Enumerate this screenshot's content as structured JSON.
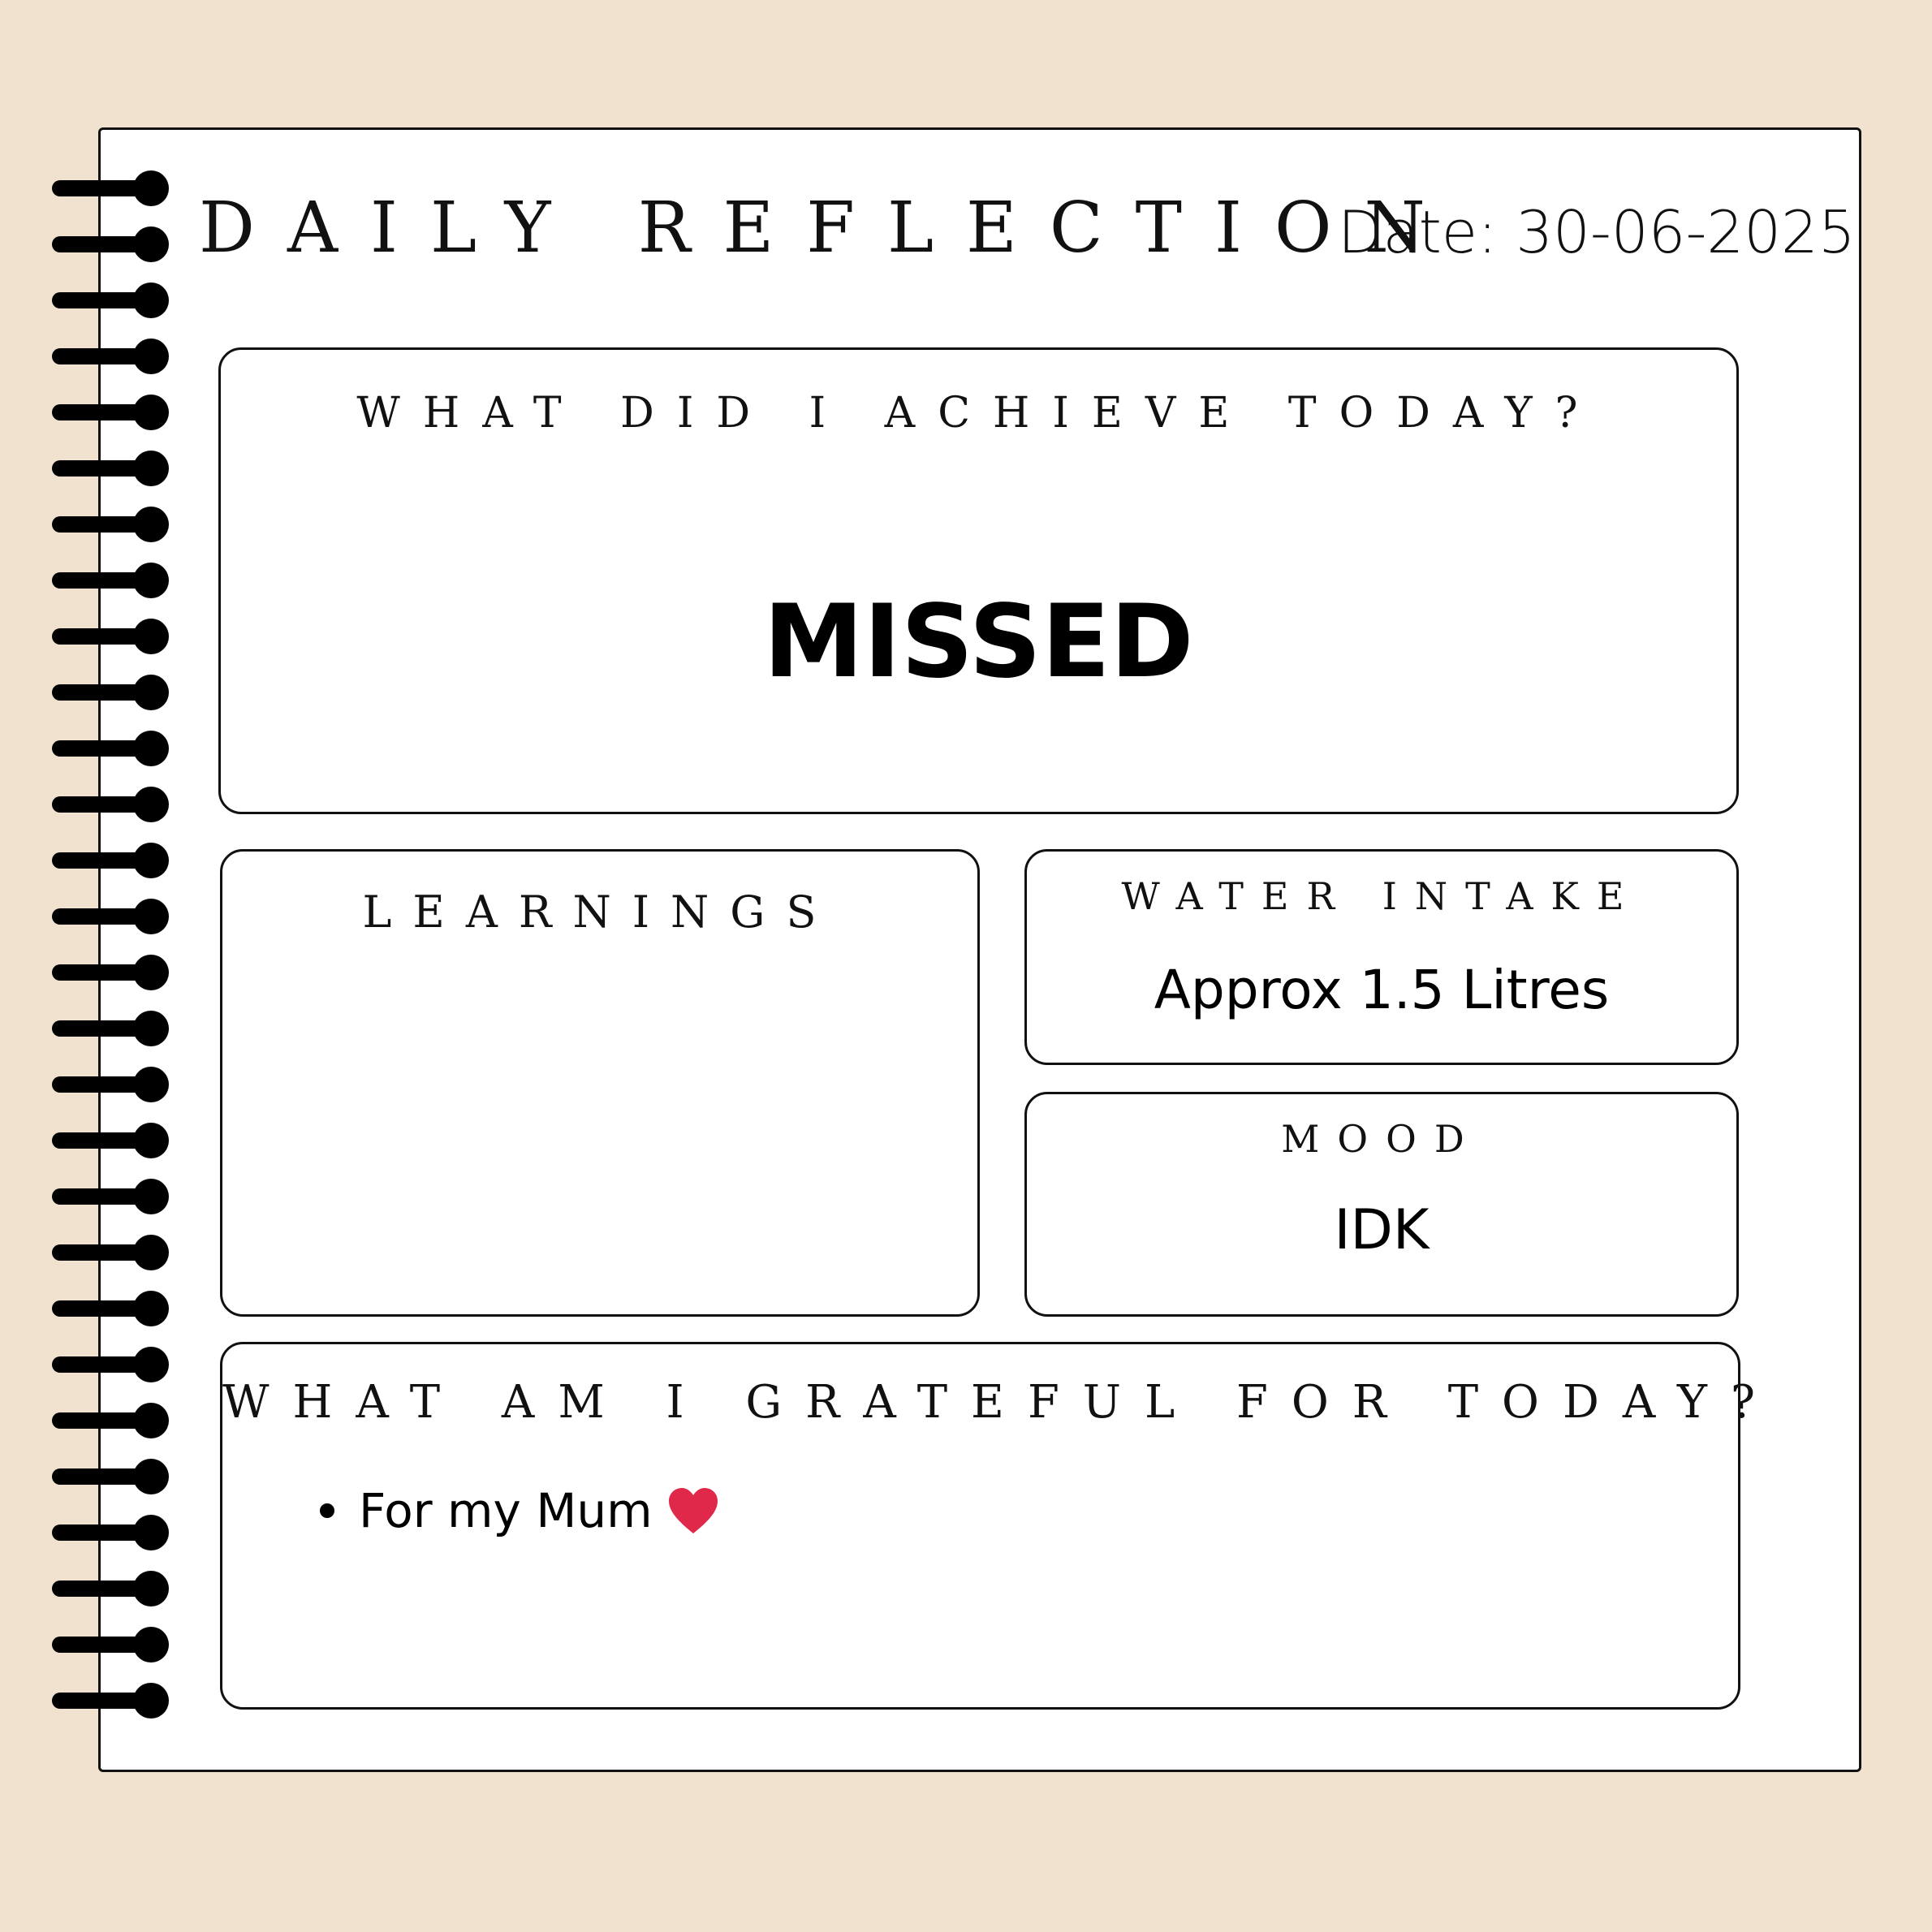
{
  "header": {
    "title": "DAILY REFLECTION",
    "date": "Date: 30-06-2025"
  },
  "sections": {
    "achieve": {
      "label": "WHAT DID I ACHIEVE TODAY?",
      "value": "MISSED"
    },
    "learnings": {
      "label": "LEARNINGS",
      "value": ""
    },
    "water": {
      "label": "WATER INTAKE",
      "value": "Approx 1.5 Litres"
    },
    "mood": {
      "label": "MOOD",
      "value": "IDK"
    },
    "grateful": {
      "label": "WHAT AM I GRATEFUL FOR TODAY?",
      "items": [
        {
          "text": "For my Mum",
          "icon": "heart-icon"
        }
      ]
    }
  },
  "colors": {
    "background": "#f0e2cf",
    "page": "#ffffff",
    "ink": "#111111",
    "heart": "#e0294a"
  },
  "binding_rings": 28
}
